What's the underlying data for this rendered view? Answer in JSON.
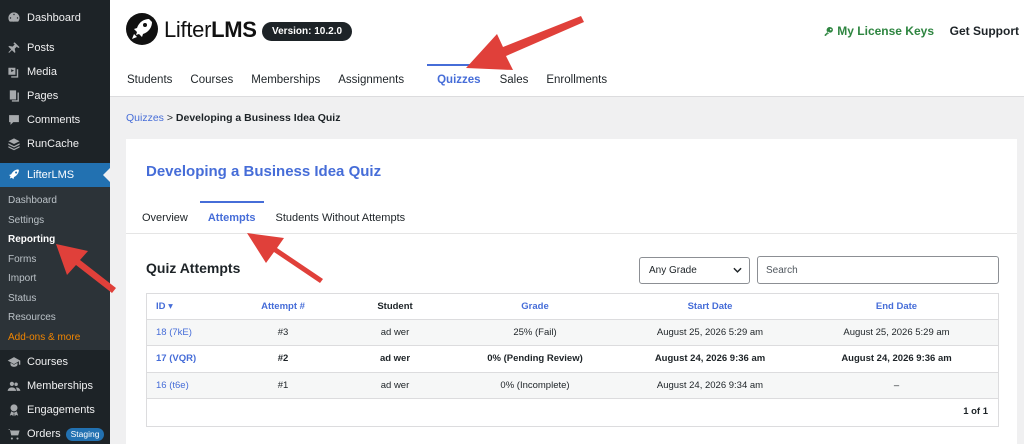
{
  "sidebar": {
    "items_top": [
      {
        "label": "Dashboard",
        "icon": "dashboard-icon"
      },
      {
        "label": "Posts",
        "icon": "pin-icon"
      },
      {
        "label": "Media",
        "icon": "media-icon"
      },
      {
        "label": "Pages",
        "icon": "pages-icon"
      },
      {
        "label": "Comments",
        "icon": "comments-icon"
      },
      {
        "label": "RunCache",
        "icon": "runcache-icon"
      }
    ],
    "active": {
      "label": "LifterLMS",
      "icon": "lifterlms-rocket-icon"
    },
    "submenu": [
      "Dashboard",
      "Settings",
      "Reporting",
      "Forms",
      "Import",
      "Status",
      "Resources",
      "Add-ons & more"
    ],
    "items_bottom": [
      {
        "label": "Courses",
        "icon": "courses-icon"
      },
      {
        "label": "Memberships",
        "icon": "memberships-icon"
      },
      {
        "label": "Engagements",
        "icon": "engagements-icon"
      },
      {
        "label": "Orders",
        "icon": "cart-icon",
        "badge": "Staging"
      }
    ]
  },
  "header": {
    "brand_light": "Lifter",
    "brand_bold": "LMS",
    "version": "Version: 10.2.0",
    "license_link": "My License Keys",
    "support_link": "Get Support",
    "nav": [
      "Students",
      "Courses",
      "Memberships",
      "Assignments",
      "Quizzes",
      "Sales",
      "Enrollments"
    ]
  },
  "breadcrumb": {
    "parent": "Quizzes",
    "sep": " > ",
    "current": "Developing a Business Idea Quiz"
  },
  "card": {
    "title": "Developing a Business Idea Quiz",
    "tabs": [
      "Overview",
      "Attempts",
      "Students Without Attempts"
    ]
  },
  "attempts": {
    "title": "Quiz Attempts",
    "grade_filter": "Any Grade",
    "search_placeholder": "Search",
    "columns": [
      "ID ▾",
      "Attempt #",
      "Student",
      "Grade",
      "Start Date",
      "End Date"
    ],
    "rows": [
      [
        "18 (7kE)",
        "#3",
        "ad wer",
        "25% (Fail)",
        "August 25, 2026 5:29 am",
        "August 25, 2026 5:29 am"
      ],
      [
        "17 (VQR)",
        "#2",
        "ad wer",
        "0% (Pending Review)",
        "August 24, 2026 9:36 am",
        "August 24, 2026 9:36 am"
      ],
      [
        "16 (t6e)",
        "#1",
        "ad wer",
        "0% (Incomplete)",
        "August 24, 2026 9:34 am",
        "–"
      ]
    ],
    "pagination": "1 of 1"
  },
  "colors": {
    "accent": "#466dd8",
    "wp_blue": "#2271b1",
    "license_green": "#2e8540",
    "arrow_red": "#e0403a"
  }
}
